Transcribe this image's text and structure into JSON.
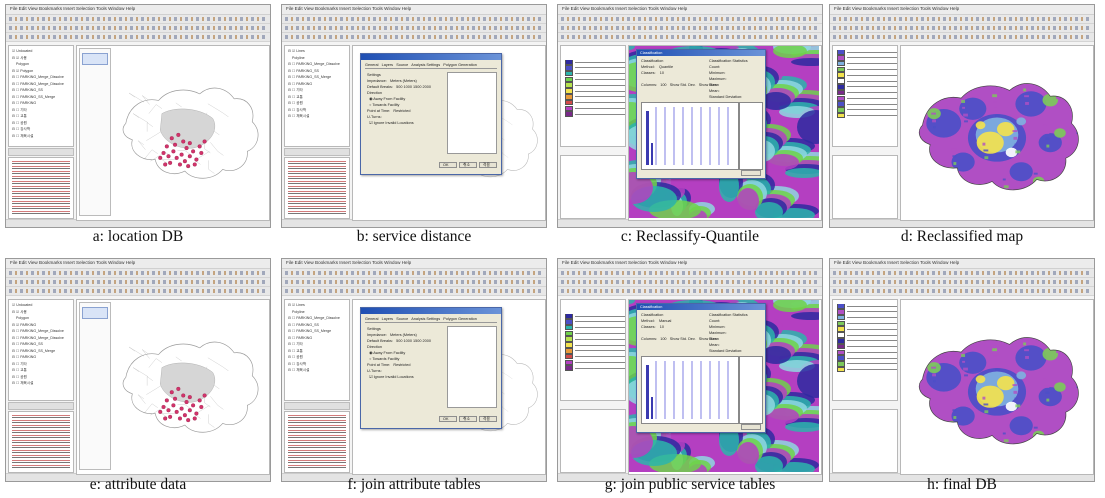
{
  "figure": {
    "panels": [
      {
        "id": "a",
        "caption": "a: location DB",
        "variant": "points",
        "menu": "File  Edit  View  Bookmarks  Insert  Selection  Tools  Window  Help",
        "tree": "☑ Unlocated\n⊟ ☑ 사용\n    Polygon\n⊟ ☑ Polygon\n⊟ ☐ PARKING_Merge_Dissolve\n⊟ ☐ PARKING_Merge_Dissolve\n⊟ ☐ PARKING_SS\n⊟ ☐ PARKING_SS_Merge\n⊟ ☐ PARKING\n⊟ ☐ 기타\n⊟ ☐ 교통\n⊟ ☐ 공원\n⊟ ☐ 강사학\n⊟ ☐ 체육시설"
      },
      {
        "id": "b",
        "caption": "b: service distance",
        "variant": "dialog",
        "menu": "File  Edit  View  Bookmarks  Insert  Selection  Tools  Window  Help",
        "tree": "⊟ ☑ Lines\n    Polyline\n⊟ ☐ PARKING_Merge_Dissolve\n⊟ ☐ PARKING_SS\n⊟ ☐ PARKING_SS_Merge\n⊟ ☐ PARKING\n⊟ ☐ 기타\n⊟ ☐ 교통\n⊟ ☐ 공원\n⊟ ☐ 강사학\n⊟ ☐ 체육시설",
        "dialog_tabs": "General   Layers   Source   Analysis Settings   Polygon Generation",
        "dialog_fields": "Settings\nImpedance:   Meters (Meters)\nDefault Breaks:   500 1000 1500 2000\nDirection\n  ◉ Away From Facility\n  ○ Towards Facility\nPoint at Time:   Restricted\nU-Turns:\n  ☑ Ignore Invalid Locations",
        "dialog_buttons": [
          "OK",
          "취소",
          "적용"
        ]
      },
      {
        "id": "c",
        "caption": "c: Reclassify-Quantile",
        "variant": "classify",
        "menu": "File  Edit  View  Bookmarks  Insert  Selection  Tools  Window  Help",
        "dialog_title": "Classification",
        "dialog_fields": "Classification\nMethod:    Quantile\nClasses:    10\n\nColumns:   100   Show Std. Dev.   Show Mean",
        "stats": "Classification Statistics\nCount:\nMinimum:\nMaximum:\nSum:\nMean:\nStandard Deviation:"
      },
      {
        "id": "d",
        "caption": "d: Reclassified map",
        "variant": "reclass",
        "menu": "File  Edit  View  Bookmarks  Insert  Selection  Tools  Window  Help"
      },
      {
        "id": "e",
        "caption": "e: attribute data",
        "variant": "points",
        "menu": "File  Edit  View  Bookmarks  Insert  Selection  Tools  Window  Help",
        "tree": "☑ Unlocated\n⊟ ☑ 사용\n    Polygon\n⊟ ☑ PARKING\n⊟ ☐ PARKING_Merge_Dissolve\n⊟ ☐ PARKING_Merge_Dissolve\n⊟ ☐ PARKING_SS\n⊟ ☐ PARKING_SS_Merge\n⊟ ☐ PARKING\n⊟ ☐ 기타\n⊟ ☐ 교통\n⊟ ☐ 공원\n⊟ ☐ 체육시설"
      },
      {
        "id": "f",
        "caption": "f: join attribute tables",
        "variant": "dialog",
        "menu": "File  Edit  View  Bookmarks  Insert  Selection  Tools  Window  Help",
        "tree": "⊟ ☑ Lines\n    Polyline\n⊟ ☐ PARKING_Merge_Dissolve\n⊟ ☐ PARKING_SS\n⊟ ☐ PARKING_SS_Merge\n⊟ ☐ PARKING\n⊟ ☐ 기타\n⊟ ☐ 교통\n⊟ ☐ 공원\n⊟ ☐ 강사학\n⊟ ☐ 체육시설",
        "dialog_tabs": "General   Layers   Source   Analysis Settings   Polygon Generation",
        "dialog_fields": "Settings\nImpedance:   Meters (Meters)\nDefault Breaks:   500 1000 1500 2000\nDirection\n  ◉ Away From Facility\n  ○ Towards Facility\nPoint at Time:   Restricted\nU-Turns:\n  ☑ Ignore Invalid Locations",
        "dialog_buttons": [
          "OK",
          "취소",
          "적용"
        ]
      },
      {
        "id": "g",
        "caption": "g: join public service tables",
        "variant": "classify",
        "menu": "File  Edit  View  Bookmarks  Insert  Selection  Tools  Window  Help",
        "dialog_title": "Classification",
        "dialog_fields": "Classification\nMethod:    Manual\nClasses:    10\n\nColumns:   100   Show Std. Dev.   Show Mean",
        "stats": "Classification Statistics\nCount:\nMinimum:\nMaximum:\nSum:\nMean:\nStandard Deviation:"
      },
      {
        "id": "h",
        "caption": "h: final DB",
        "variant": "reclass",
        "menu": "File  Edit  View  Bookmarks  Insert  Selection  Tools  Window  Help"
      }
    ]
  },
  "colors": {
    "points": "#d2336b",
    "boundary": "#9a9a9a",
    "reclass_purple": "#b04fc4",
    "reclass_blue": "#4c4fc7",
    "reclass_lightblue": "#7fb0e0",
    "reclass_green": "#7cc95a",
    "reclass_yellow": "#f2e24e",
    "raster_magenta": "#b43fc1",
    "raster_teal": "#2bb5ac",
    "raster_green": "#6fd24a",
    "raster_navy": "#2e2aa0"
  }
}
